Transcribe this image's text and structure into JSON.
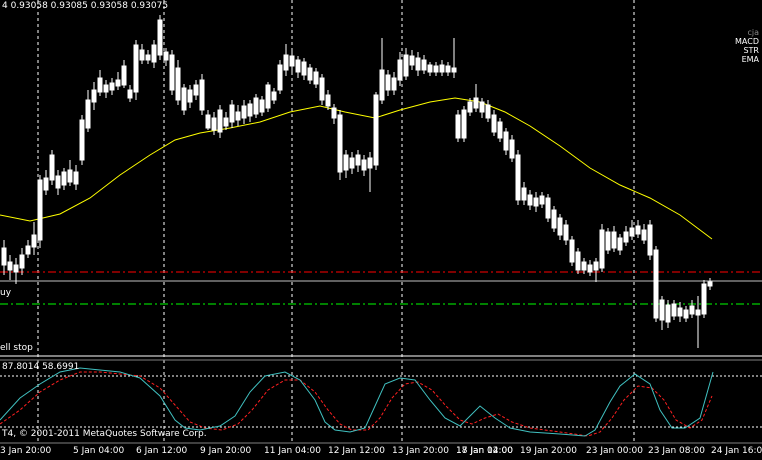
{
  "header": {
    "ohlc": "4  0.93058 0.93085 0.93058 0.93075"
  },
  "legend": {
    "items": [
      "cja",
      "MACD",
      "STR",
      "EMA"
    ]
  },
  "labels": {
    "buy": "uy",
    "sell": "ell stop"
  },
  "stoch": {
    "values": "87.8014 58.6991"
  },
  "copyright": "T4, © 2001-2011 MetaQuotes Software Corp.",
  "xaxis": {
    "labels": [
      "3 Jan 20:00",
      "5 Jan 04:00",
      "6 Jan 12:00",
      "9 Jan 20:00",
      "11 Jan 04:00",
      "12 Jan 12:00",
      "13 Jan 20:00",
      "17 Jan 04:00",
      "18 Jan 12:00",
      "19 Jan 20:00",
      "23 Jan 00:00",
      "23 Jan 08:00",
      "24 Jan 16:00"
    ]
  },
  "colors": {
    "bull": "#00ff00",
    "bear": "#ffffff",
    "ema": "#ffff00",
    "sell_line": "#ff0000",
    "buy_line": "#00ff00",
    "stoch_main": "#40c0c0",
    "stoch_signal": "#ff2020",
    "grid": "#ffffff"
  }
}
